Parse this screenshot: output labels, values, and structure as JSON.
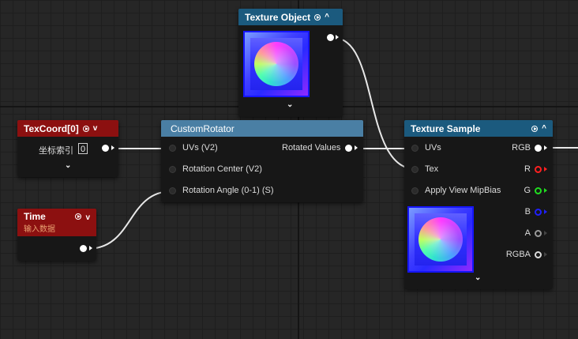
{
  "colors": {
    "accent_blue": "#1b5a7e",
    "param_red": "#8c1010",
    "custom_steel": "#4a7fa4",
    "pin_red": "#ff2020",
    "pin_green": "#20dd20",
    "pin_blue": "#2020ff"
  },
  "texture_object": {
    "title": "Texture Object"
  },
  "texcoord": {
    "title": "TexCoord[0]",
    "index_label": "坐标索引",
    "index_value": "0"
  },
  "time": {
    "title": "Time",
    "subtitle": "输入数据"
  },
  "custom_rotator": {
    "title": "CustomRotator",
    "inputs": [
      "UVs (V2)",
      "Rotation Center (V2)",
      "Rotation Angle (0-1) (S)"
    ],
    "output": "Rotated Values"
  },
  "texture_sample": {
    "title": "Texture Sample",
    "inputs": [
      "UVs",
      "Tex",
      "Apply View MipBias"
    ],
    "outputs": [
      "RGB",
      "R",
      "G",
      "B",
      "A",
      "RGBA"
    ]
  }
}
